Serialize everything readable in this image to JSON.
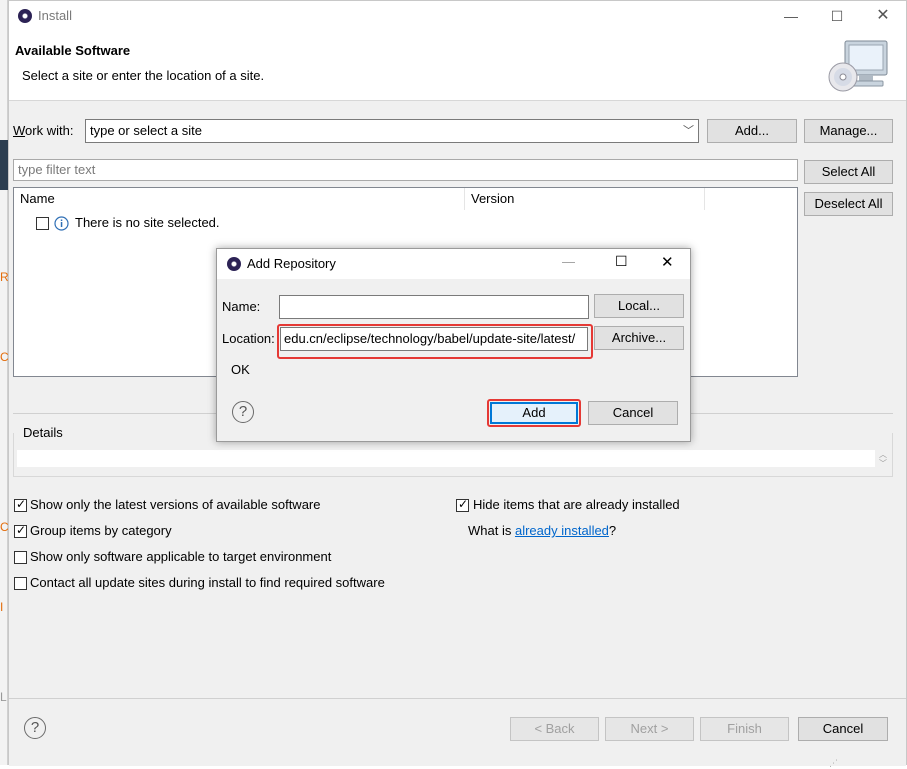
{
  "window": {
    "title": "Install"
  },
  "header": {
    "title": "Available Software",
    "subtitle": "Select a site or enter the location of a site."
  },
  "work_with": {
    "label_prefix": "W",
    "label_rest": "ork with:",
    "value": "type or select a site",
    "add_button": "Add...",
    "manage_button": "Manage..."
  },
  "filter": {
    "placeholder": "type filter text"
  },
  "select_all": "Select All",
  "deselect_all": "Deselect All",
  "table": {
    "columns": [
      "Name",
      "Version"
    ],
    "rows": [
      {
        "name": "There is no site selected."
      }
    ]
  },
  "details": {
    "label": "Details"
  },
  "options": {
    "latest": {
      "text": "Show only the latest versions of available software",
      "checked": true
    },
    "group": {
      "text": "Group items by category",
      "checked": true
    },
    "target": {
      "text": "Show only software applicable to target environment",
      "checked": false
    },
    "contact": {
      "text": "Contact all update sites during install to find required software",
      "checked": false
    },
    "hide_installed": {
      "text": "Hide items that are already installed",
      "checked": true
    },
    "what_is_prefix": "What is ",
    "already_installed_link": "already installed",
    "what_is_suffix": "?"
  },
  "footer": {
    "back": "< Back",
    "next": "Next >",
    "finish": "Finish",
    "cancel": "Cancel"
  },
  "dialog": {
    "title": "Add Repository",
    "name_label": "Name:",
    "name_value": "",
    "local_button": "Local...",
    "location_label": "Location:",
    "location_value": "edu.cn/eclipse/technology/babel/update-site/latest/",
    "archive_button": "Archive...",
    "status": "OK",
    "add_button": "Add",
    "cancel_button": "Cancel"
  },
  "colors": {
    "highlight": "#e53935",
    "link": "#0066cc",
    "focus": "#0078d7"
  },
  "icons": [
    "eclipse-icon",
    "info-icon",
    "help-icon",
    "install-cd-icon"
  ]
}
